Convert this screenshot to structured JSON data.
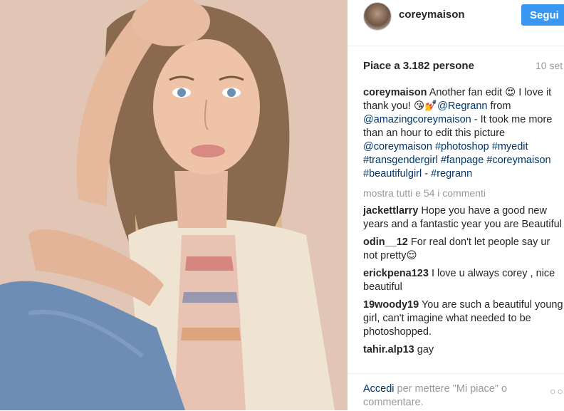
{
  "post": {
    "username": "coreymaison",
    "follow_label": "Segui",
    "likes_text": "Piace a 3.182 persone",
    "date_text": "10 set",
    "caption": {
      "user": "coreymaison",
      "text_a": " Another fan edit ",
      "emoji_a": "😍",
      "text_b": " I love it thank you! ",
      "emoji_b": "😘💅",
      "mention_a": "@Regrann",
      "text_c": " from ",
      "mention_b": "@amazingcoreymaison",
      "text_d": " - It took me more than an hour to edit this picture ",
      "mention_c": "@coreymaison",
      "space": " ",
      "tags_a": "#photoshop #myedit #transgendergirl #fanpage #coreymaison #beautifulgirl",
      "text_e": " - ",
      "tags_b": "#regrann"
    },
    "more_comments_label": "mostra tutti e 54 i commenti",
    "comments": [
      {
        "user": "jackettlarry",
        "text": "Hope you have a good new years and a fantastic year you are Beautiful"
      },
      {
        "user": "odin__12",
        "text": "For real don't let people say ur not pretty😌"
      },
      {
        "user": "erickpena123",
        "text": "I love u always corey , nice beautiful"
      },
      {
        "user": "19woody19",
        "text": "You are such a beautiful young girl, can't imagine what needed to be photoshopped."
      },
      {
        "user": "tahir.alp13",
        "text": "gay"
      }
    ],
    "footer": {
      "login_label": "Accedi",
      "rest_text": " per mettere \"Mi piace\" o commentare.",
      "dots_icon": "more-options-icon",
      "dots_glyph": "○○"
    }
  },
  "colors": {
    "accent": "#3897f0",
    "link": "#003569",
    "muted": "#999999"
  }
}
